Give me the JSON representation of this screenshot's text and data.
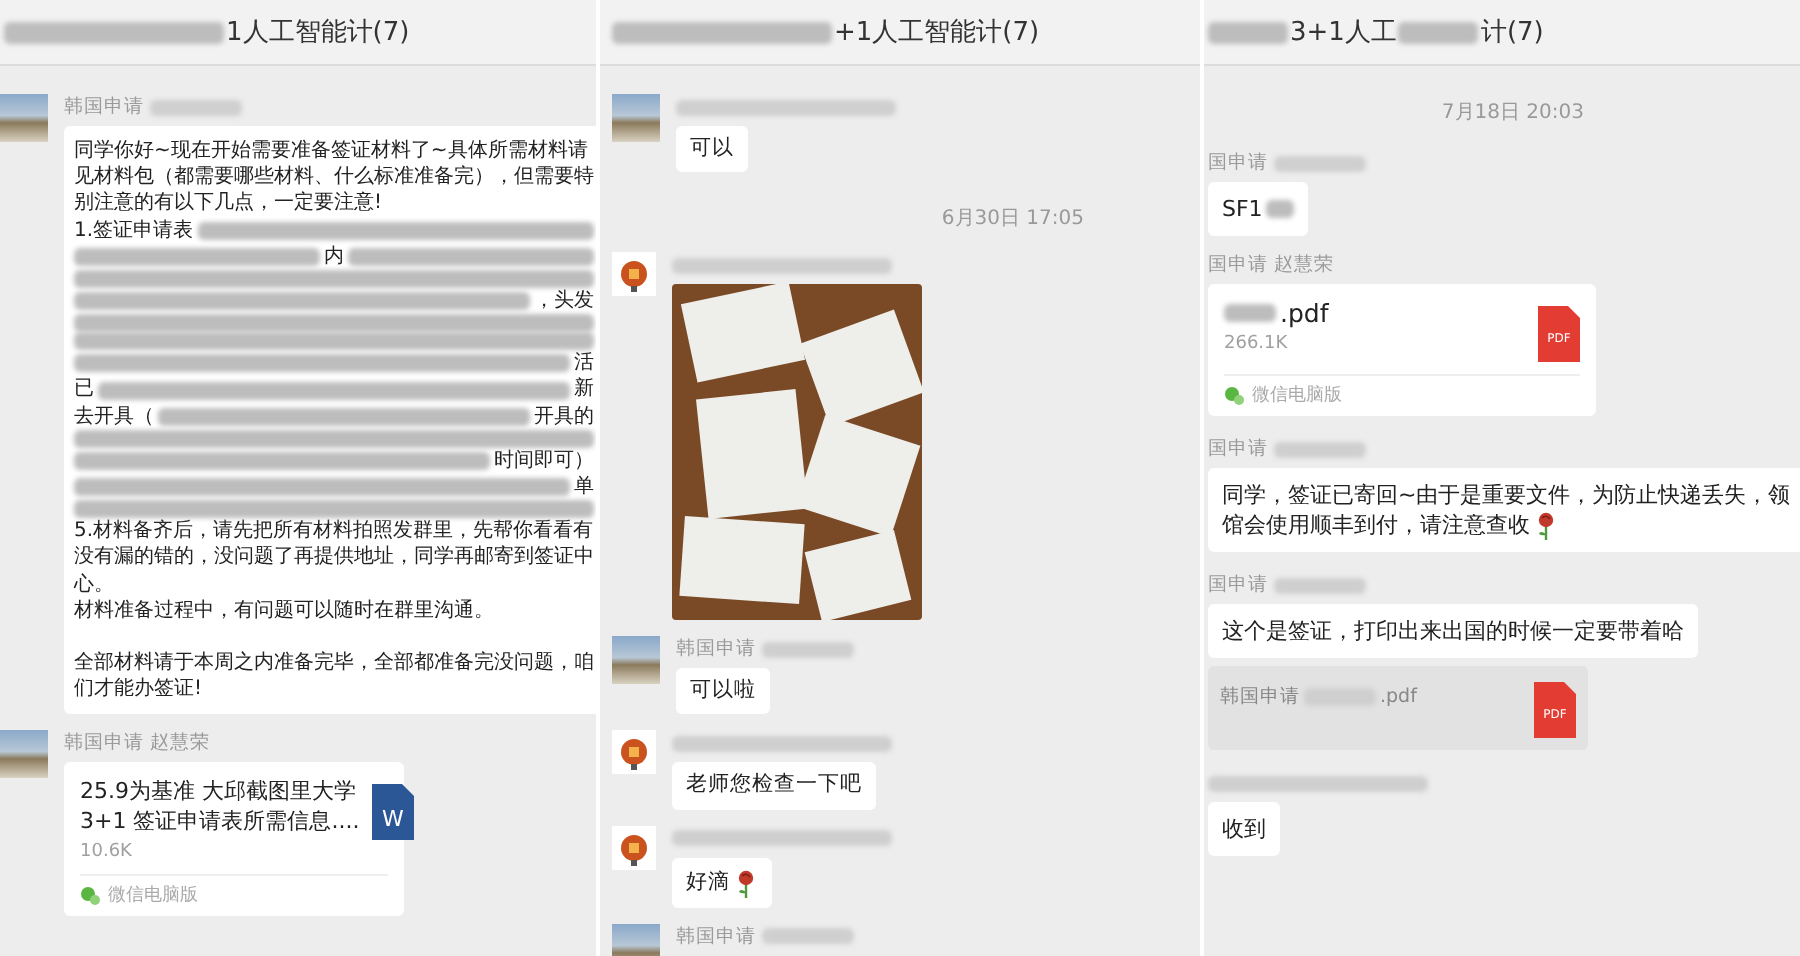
{
  "panels": [
    {
      "title": [
        {
          "kind": "blur"
        },
        {
          "kind": "text",
          "text": "1人工智能计(7)"
        }
      ],
      "messages": [
        {
          "kind": "text",
          "avatar": {
            "kind": "photo"
          },
          "sender": [
            {
              "kind": "text",
              "text": "韩国申请"
            },
            {
              "kind": "blur"
            }
          ],
          "paragraphs": [
            [
              [
                {
                  "kind": "text",
                  "text": "同学你好~现在开始需要准备签证材料了~具体所需材料请"
                }
              ],
              [
                {
                  "kind": "text",
                  "text": "见材料包（都需要哪些材料、什么标准准备完），但需要特"
                }
              ],
              [
                {
                  "kind": "text",
                  "text": "别注意的有以下几点，一定要注意!"
                }
              ],
              [
                {
                  "kind": "text",
                  "text": "1.签证申请表"
                },
                {
                  "kind": "blur"
                }
              ],
              [
                {
                  "kind": "blur"
                },
                {
                  "kind": "text",
                  "text": "内"
                },
                {
                  "kind": "blur"
                }
              ],
              [
                {
                  "kind": "blur"
                }
              ],
              [
                {
                  "kind": "blur"
                },
                {
                  "kind": "text",
                  "text": "，头发"
                }
              ],
              [
                {
                  "kind": "blur"
                }
              ],
              [
                {
                  "kind": "blur"
                }
              ],
              [
                {
                  "kind": "blur"
                },
                {
                  "kind": "text",
                  "text": "活"
                }
              ],
              [
                {
                  "kind": "text",
                  "text": "已"
                },
                {
                  "kind": "blur"
                },
                {
                  "kind": "text",
                  "text": "新"
                }
              ],
              [
                {
                  "kind": "text",
                  "text": "去开具（"
                },
                {
                  "kind": "blur"
                },
                {
                  "kind": "text",
                  "text": "开具的"
                }
              ],
              [
                {
                  "kind": "blur"
                }
              ],
              [
                {
                  "kind": "blur"
                },
                {
                  "kind": "text",
                  "text": "时间即可）"
                }
              ],
              [
                {
                  "kind": "blur"
                },
                {
                  "kind": "text",
                  "text": "单"
                }
              ],
              [
                {
                  "kind": "blur"
                }
              ],
              [
                {
                  "kind": "text",
                  "text": "5.材料备齐后，请先把所有材料拍照发群里，先帮你看看有"
                }
              ],
              [
                {
                  "kind": "text",
                  "text": "没有漏的错的，没问题了再提供地址，同学再邮寄到签证中"
                }
              ],
              [
                {
                  "kind": "text",
                  "text": "心。"
                }
              ],
              [
                {
                  "kind": "text",
                  "text": "材料准备过程中，有问题可以随时在群里沟通。"
                }
              ]
            ],
            [
              [
                {
                  "kind": "text",
                  "text": "全部材料请于本周之内准备完毕，全部都准备完没问题，咱"
                }
              ],
              [
                {
                  "kind": "text",
                  "text": "们才能办签证!"
                }
              ]
            ]
          ]
        },
        {
          "kind": "file",
          "avatar": {
            "kind": "photo"
          },
          "sender": [
            {
              "kind": "text",
              "text": "韩国申请 赵慧荣"
            }
          ],
          "name_lines": [
            [
              {
                "kind": "text",
                "text": "25.9为基准 大邱截图里大学"
              }
            ],
            [
              {
                "kind": "text",
                "text": "3+1  签证申请表所需信息...."
              }
            ]
          ],
          "size": "10.6K",
          "source": "微信电脑版",
          "icon": {
            "kind": "word",
            "label": "W"
          }
        }
      ]
    },
    {
      "title": [
        {
          "kind": "blur"
        },
        {
          "kind": "text",
          "text": "+1人工智能计(7)"
        }
      ],
      "messages": [
        {
          "kind": "text",
          "avatar": {
            "kind": "photo"
          },
          "sender": [
            {
              "kind": "blur"
            }
          ],
          "lines": [
            [
              {
                "kind": "text",
                "text": "可以"
              }
            ]
          ]
        },
        {
          "kind": "time",
          "text": "6月30日 17:05"
        },
        {
          "kind": "image",
          "avatar": {
            "kind": "logo"
          },
          "sender": [
            {
              "kind": "blur"
            }
          ]
        },
        {
          "kind": "text",
          "avatar": {
            "kind": "photo"
          },
          "sender": [
            {
              "kind": "text",
              "text": "韩国申请"
            },
            {
              "kind": "blur"
            }
          ],
          "lines": [
            [
              {
                "kind": "text",
                "text": "可以啦"
              }
            ]
          ]
        },
        {
          "kind": "text",
          "avatar": {
            "kind": "logo"
          },
          "sender": [
            {
              "kind": "blur"
            }
          ],
          "lines": [
            [
              {
                "kind": "text",
                "text": "老师您检查一下吧"
              }
            ]
          ]
        },
        {
          "kind": "text",
          "avatar": {
            "kind": "logo"
          },
          "sender": [
            {
              "kind": "blur"
            }
          ],
          "lines": [
            [
              {
                "kind": "text",
                "text": "好滴"
              },
              {
                "kind": "rose"
              }
            ]
          ]
        },
        {
          "kind": "text",
          "avatar": {
            "kind": "photo"
          },
          "sender": [
            {
              "kind": "text",
              "text": "韩国申请"
            },
            {
              "kind": "blur"
            }
          ]
        }
      ]
    },
    {
      "title": [
        {
          "kind": "blur"
        },
        {
          "kind": "text",
          "text": "3+1人工"
        },
        {
          "kind": "blur"
        },
        {
          "kind": "text",
          "text": "计(7)"
        }
      ],
      "messages": [
        {
          "kind": "time",
          "text": "7月18日 20:03"
        },
        {
          "kind": "text",
          "sender": [
            {
              "kind": "text",
              "text": "国申请"
            },
            {
              "kind": "blur"
            }
          ],
          "lines": [
            [
              {
                "kind": "text",
                "text": "SF1"
              },
              {
                "kind": "blur"
              }
            ]
          ]
        },
        {
          "kind": "file",
          "sender": [
            {
              "kind": "text",
              "text": "国申请 赵慧荣"
            }
          ],
          "name_lines": [
            [
              {
                "kind": "blur"
              },
              {
                "kind": "text",
                "text": ".pdf"
              }
            ]
          ],
          "size": "266.1K",
          "source": "微信电脑版",
          "icon": {
            "kind": "pdf",
            "label": "PDF"
          }
        },
        {
          "kind": "text",
          "sender": [
            {
              "kind": "text",
              "text": "国申请"
            },
            {
              "kind": "blur"
            }
          ],
          "lines": [
            [
              {
                "kind": "text",
                "text": "同学，签证已寄回~由于是重要文件，为防止快递丢失，领"
              }
            ],
            [
              {
                "kind": "text",
                "text": "馆会使用顺丰到付，请注意查收"
              },
              {
                "kind": "rose"
              }
            ]
          ]
        },
        {
          "kind": "text",
          "sender": [
            {
              "kind": "text",
              "text": "国申请"
            },
            {
              "kind": "blur"
            }
          ],
          "lines": [
            [
              {
                "kind": "text",
                "text": "这个是签证，打印出来出国的时候一定要带着哈"
              }
            ]
          ]
        },
        {
          "kind": "quote",
          "parts": [
            {
              "kind": "text",
              "text": "韩国申请"
            },
            {
              "kind": "blur"
            },
            {
              "kind": "text",
              "text": ".pdf"
            }
          ],
          "icon": {
            "kind": "pdf",
            "label": "PDF"
          }
        },
        {
          "kind": "text",
          "sender": [
            {
              "kind": "blur"
            }
          ],
          "lines": [
            [
              {
                "kind": "text",
                "text": "收到"
              }
            ]
          ]
        }
      ]
    }
  ]
}
